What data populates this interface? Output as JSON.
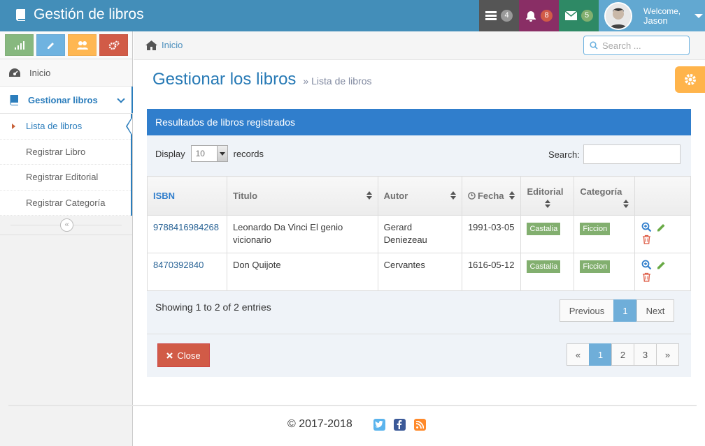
{
  "app": {
    "title": "Gestión de libros"
  },
  "navbar": {
    "tasks_count": "4",
    "notifications_count": "8",
    "messages_count": "5",
    "welcome": "Welcome,",
    "user_name": "Jason"
  },
  "sidebar": {
    "menu": [
      {
        "label": "Inicio",
        "icon": "tachometer-icon"
      },
      {
        "label": "Gestionar libros",
        "icon": "book-icon"
      }
    ],
    "submenu": [
      {
        "label": "Lista de libros",
        "active": true
      },
      {
        "label": "Registrar Libro"
      },
      {
        "label": "Registrar Editorial"
      },
      {
        "label": "Registrar Categoría"
      }
    ]
  },
  "breadcrumb": {
    "home": "Inicio"
  },
  "search": {
    "placeholder": "Search ..."
  },
  "page": {
    "title": "Gestionar los libros",
    "subtitle": "Lista de libros"
  },
  "widget": {
    "title": "Resultados de libros registrados",
    "display_label": "Display",
    "display_value": "10",
    "records_label": "records",
    "search_label": "Search:"
  },
  "table": {
    "columns": [
      "ISBN",
      "Titulo",
      "Autor",
      "Fecha",
      "Editorial",
      "Categoría"
    ],
    "rows": [
      {
        "isbn": "9788416984268",
        "titulo": "Leonardo Da Vinci El genio vicionario",
        "autor": "Gerard Deniezeau",
        "fecha": "1991-03-05",
        "editorial": "Castalia",
        "categoria": "Ficcion"
      },
      {
        "isbn": "8470392840",
        "titulo": "Don Quijote",
        "autor": "Cervantes",
        "fecha": "1616-05-12",
        "editorial": "Castalia",
        "categoria": "Ficcion"
      }
    ]
  },
  "pagination": {
    "info": "Showing 1 to 2 of 2 entries",
    "previous": "Previous",
    "current": "1",
    "next": "Next"
  },
  "footer_bar": {
    "close_label": "Close",
    "pages": [
      "«",
      "1",
      "2",
      "3",
      "»"
    ]
  },
  "footer": {
    "copyright": "© 2017-2018"
  },
  "colors": {
    "navbar": "#438eb9",
    "accent": "#2b7dbc",
    "label_green": "#82af6f",
    "danger": "#d15b47"
  }
}
